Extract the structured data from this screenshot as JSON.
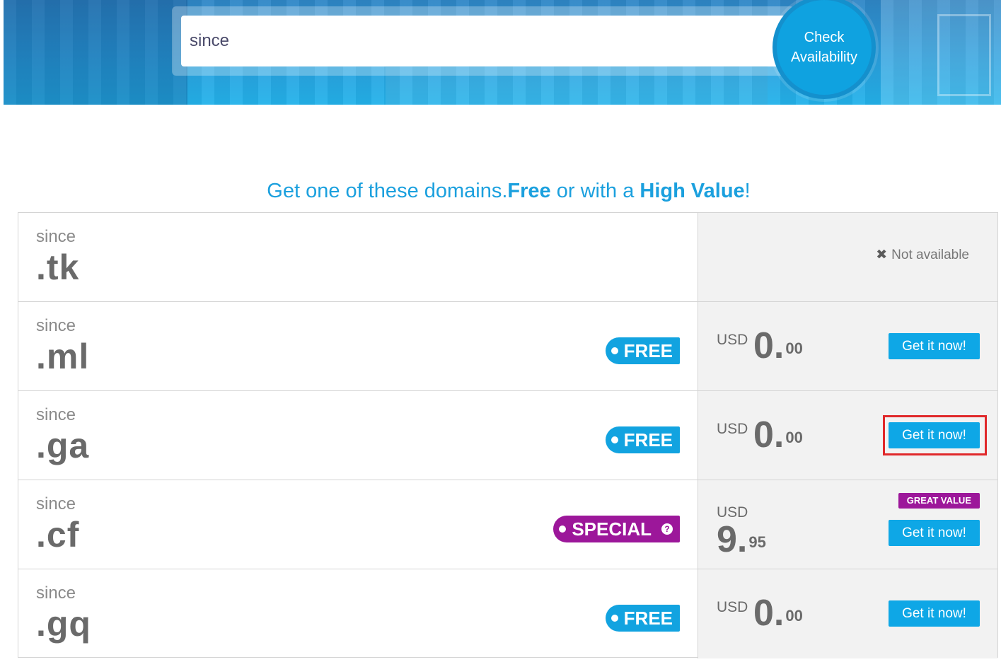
{
  "search": {
    "value": "since",
    "button_line1": "Check",
    "button_line2": "Availability"
  },
  "heading": {
    "part1": "Get one of these domains.",
    "free_word": "Free",
    "part2": " or with a ",
    "high_value": "High Value",
    "part3": "!"
  },
  "results": [
    {
      "name": "since",
      "tld": ".tk",
      "status": "Not available",
      "status_icon": "close-icon"
    },
    {
      "name": "since",
      "tld": ".ml",
      "badge": "FREE",
      "currency": "USD",
      "price_int": "0.",
      "price_cents": "00",
      "button": "Get it now!"
    },
    {
      "name": "since",
      "tld": ".ga",
      "badge": "FREE",
      "currency": "USD",
      "price_int": "0.",
      "price_cents": "00",
      "button": "Get it now!",
      "highlighted": true
    },
    {
      "name": "since",
      "tld": ".cf",
      "badge": "SPECIAL",
      "badge_icon": "help-icon",
      "tag": "GREAT VALUE",
      "currency": "USD",
      "price_int": "9.",
      "price_cents": "95",
      "button": "Get it now!"
    },
    {
      "name": "since",
      "tld": ".gq",
      "badge": "FREE",
      "currency": "USD",
      "price_int": "0.",
      "price_cents": "00",
      "button": "Get it now!"
    }
  ],
  "colors": {
    "accent": "#0ea7e6",
    "special": "#9c179a",
    "highlight": "#e0282a"
  }
}
